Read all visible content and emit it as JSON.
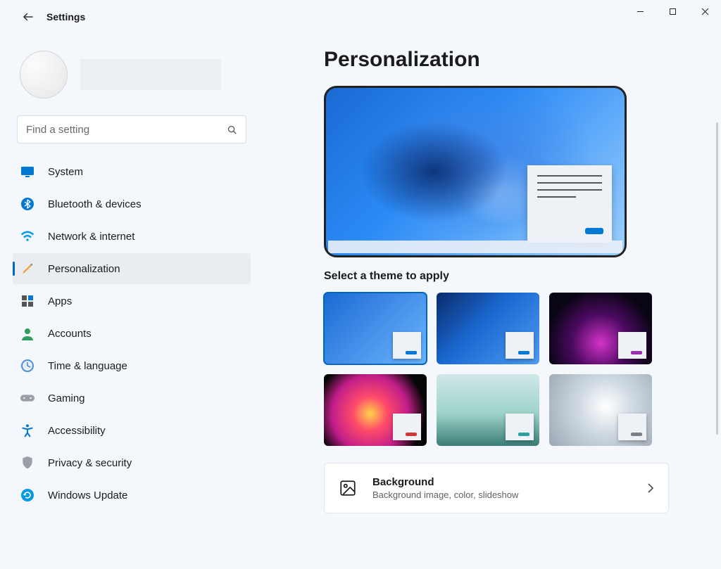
{
  "app_title": "Settings",
  "search": {
    "placeholder": "Find a setting"
  },
  "sidebar": {
    "items": [
      {
        "label": "System"
      },
      {
        "label": "Bluetooth & devices"
      },
      {
        "label": "Network & internet"
      },
      {
        "label": "Personalization"
      },
      {
        "label": "Apps"
      },
      {
        "label": "Accounts"
      },
      {
        "label": "Time & language"
      },
      {
        "label": "Gaming"
      },
      {
        "label": "Accessibility"
      },
      {
        "label": "Privacy & security"
      },
      {
        "label": "Windows Update"
      }
    ]
  },
  "main": {
    "heading": "Personalization",
    "theme_prompt": "Select a theme to apply",
    "themes": [
      {
        "name": "windows-light",
        "accent": "#0078d4",
        "selected": true
      },
      {
        "name": "windows-dark",
        "accent": "#0078d4",
        "selected": false
      },
      {
        "name": "glow",
        "accent": "#9b2fae",
        "selected": false
      },
      {
        "name": "captured-motion",
        "accent": "#d13438",
        "selected": false
      },
      {
        "name": "sunrise",
        "accent": "#2aa0a0",
        "selected": false
      },
      {
        "name": "flow",
        "accent": "#7a7f85",
        "selected": false
      }
    ],
    "background_card": {
      "title": "Background",
      "desc": "Background image, color, slideshow"
    }
  }
}
